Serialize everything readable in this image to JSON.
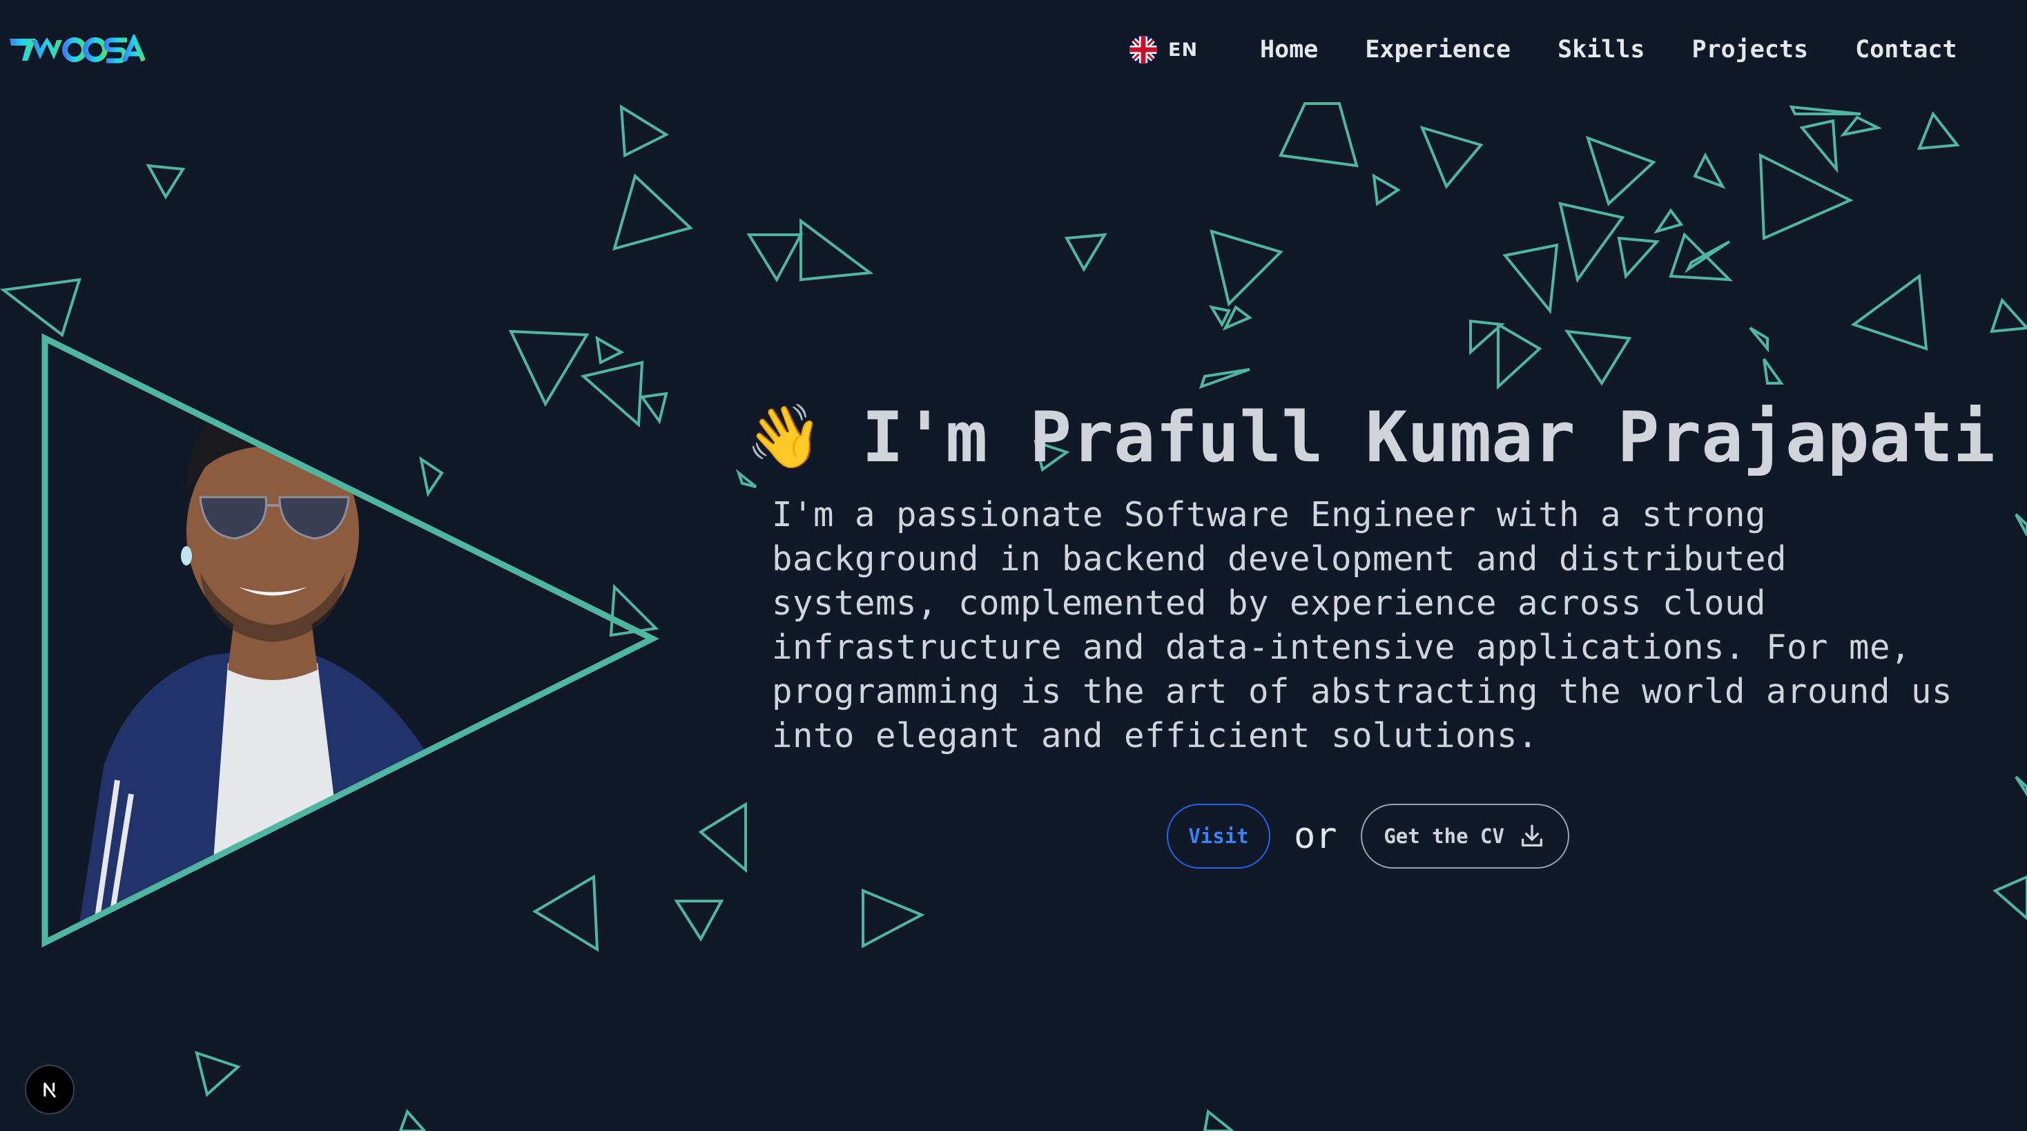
{
  "header": {
    "logo_text": "TWOOSAI",
    "language": {
      "code": "EN",
      "flag_icon": "uk-flag-icon"
    },
    "nav": [
      {
        "label": "Home"
      },
      {
        "label": "Experience"
      },
      {
        "label": "Skills"
      },
      {
        "label": "Projects"
      },
      {
        "label": "Contact"
      }
    ]
  },
  "hero": {
    "wave_emoji": "👋",
    "title": "I'm Prafull Kumar Prajapati",
    "bio": "I'm a passionate Software Engineer with a strong background in backend development and distributed systems, complemented by experience across cloud infrastructure and data-intensive applications. For me, programming is the art of abstracting the world around us into elegant and efficient solutions.",
    "visit_label": "Visit",
    "or_text": "or",
    "cv_label": "Get the CV",
    "cv_icon": "download-icon"
  },
  "dev_badge": {
    "letter": "N",
    "icon": "nextjs-icon"
  },
  "theme": {
    "background": "#111827",
    "accent": "#4fb6a0",
    "text": "#d1d5db",
    "link_blue": "#3b82f6"
  }
}
